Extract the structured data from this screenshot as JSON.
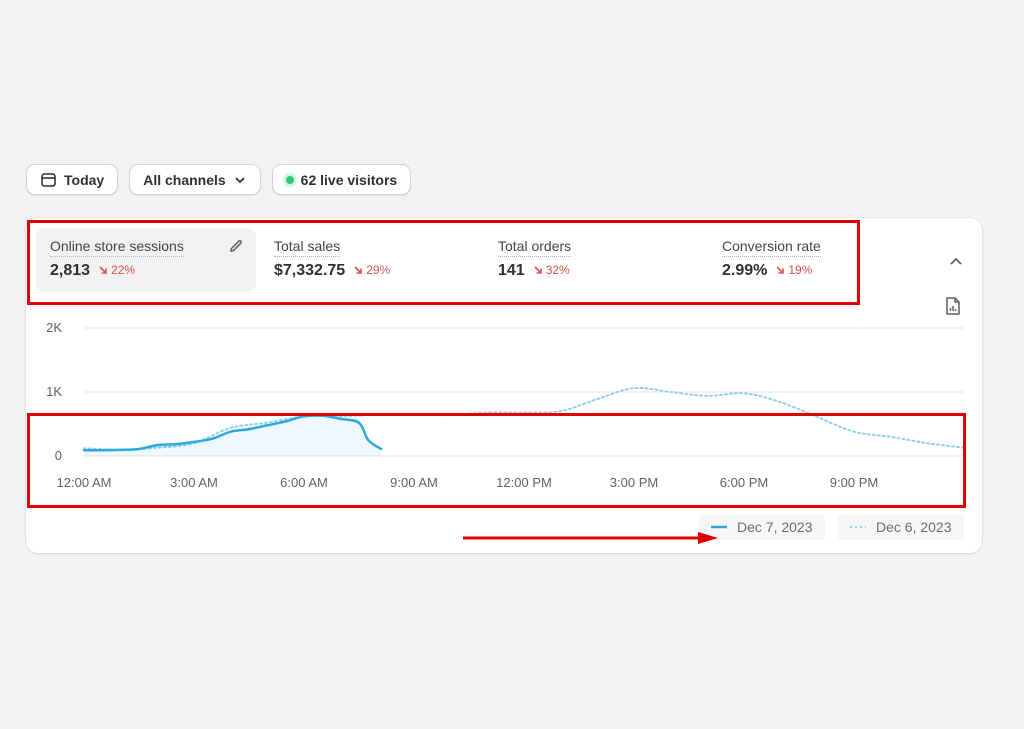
{
  "toolbar": {
    "date_label": "Today",
    "channel_label": "All channels",
    "visitors_label": "62 live visitors"
  },
  "metrics": [
    {
      "label": "Online store sessions",
      "value": "2,813",
      "change": "22%"
    },
    {
      "label": "Total sales",
      "value": "$7,332.75",
      "change": "29%"
    },
    {
      "label": "Total orders",
      "value": "141",
      "change": "32%"
    },
    {
      "label": "Conversion rate",
      "value": "2.99%",
      "change": "19%"
    }
  ],
  "colors": {
    "current": "#2ea7dd",
    "previous": "#8fd0ec",
    "decrease": "#d9534f",
    "annotation": "#e00000"
  },
  "chart_data": {
    "type": "line",
    "x_labels": [
      "12:00 AM",
      "3:00 AM",
      "6:00 AM",
      "9:00 AM",
      "12:00 PM",
      "3:00 PM",
      "6:00 PM",
      "9:00 PM"
    ],
    "y_ticks": [
      "0",
      "1K",
      "2K"
    ],
    "ylim": [
      0,
      2000
    ],
    "series": [
      {
        "name": "Dec 7, 2023",
        "style": "solid",
        "x": [
          0,
          0.5,
          1,
          1.5,
          2,
          2.5,
          3,
          3.5,
          4,
          4.5,
          5,
          5.5,
          6,
          6.5,
          7,
          7.5,
          7.75,
          8.1
        ],
        "y": [
          90,
          90,
          95,
          110,
          170,
          185,
          220,
          270,
          380,
          420,
          480,
          540,
          620,
          630,
          580,
          520,
          250,
          110
        ]
      },
      {
        "name": "Dec 6, 2023",
        "style": "dotted",
        "x": [
          0,
          1,
          2,
          3,
          4,
          5,
          6,
          7,
          8,
          9,
          10,
          11,
          12,
          13,
          14,
          15,
          16,
          17,
          18,
          19,
          20,
          21,
          22,
          23,
          24
        ],
        "y": [
          120,
          100,
          130,
          200,
          440,
          520,
          620,
          620,
          650,
          650,
          640,
          680,
          680,
          700,
          890,
          1060,
          1000,
          940,
          980,
          840,
          610,
          380,
          300,
          200,
          130
        ]
      }
    ],
    "legend_position": "bottom-right"
  }
}
